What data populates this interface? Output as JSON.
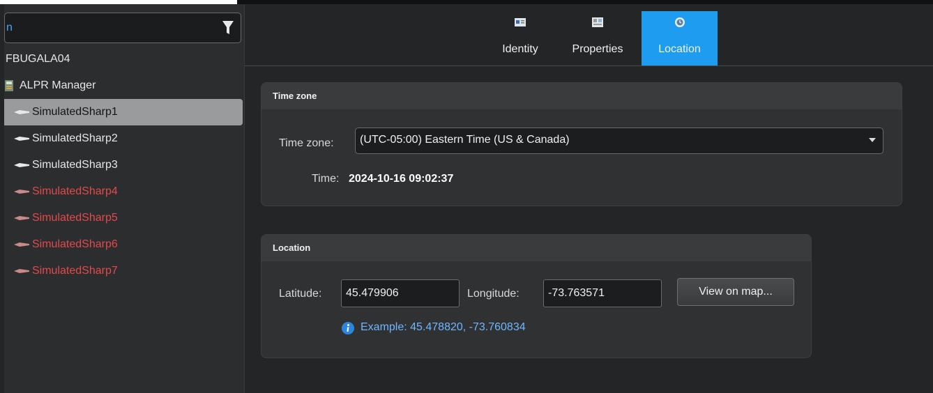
{
  "search": {
    "value": "n"
  },
  "tree": {
    "server": "FBUGALA04",
    "manager": "ALPR Manager",
    "items": [
      {
        "label": "SimulatedSharp1",
        "state": "selected"
      },
      {
        "label": "SimulatedSharp2",
        "state": "normal"
      },
      {
        "label": "SimulatedSharp3",
        "state": "normal"
      },
      {
        "label": "SimulatedSharp4",
        "state": "offline"
      },
      {
        "label": "SimulatedSharp5",
        "state": "offline"
      },
      {
        "label": "SimulatedSharp6",
        "state": "offline"
      },
      {
        "label": "SimulatedSharp7",
        "state": "offline"
      }
    ]
  },
  "tabs": [
    {
      "label": "Identity",
      "icon": "identity-card-icon"
    },
    {
      "label": "Properties",
      "icon": "properties-icon"
    },
    {
      "label": "Location",
      "icon": "globe-clock-icon",
      "active": true
    }
  ],
  "timezone_group": {
    "title": "Time zone",
    "tz_label": "Time zone:",
    "tz_value": "(UTC-05:00) Eastern Time (US & Canada)",
    "time_label": "Time:",
    "time_value": "2024-10-16 09:02:37"
  },
  "location_group": {
    "title": "Location",
    "lat_label": "Latitude:",
    "lat_value": "45.479906",
    "lon_label": "Longitude:",
    "lon_value": "-73.763571",
    "view_button": "View on map...",
    "example": "Example: 45.478820, -73.760834"
  },
  "colors": {
    "accent": "#1e9cf0",
    "offline": "#e34a4a",
    "info": "#6fb7ff"
  }
}
